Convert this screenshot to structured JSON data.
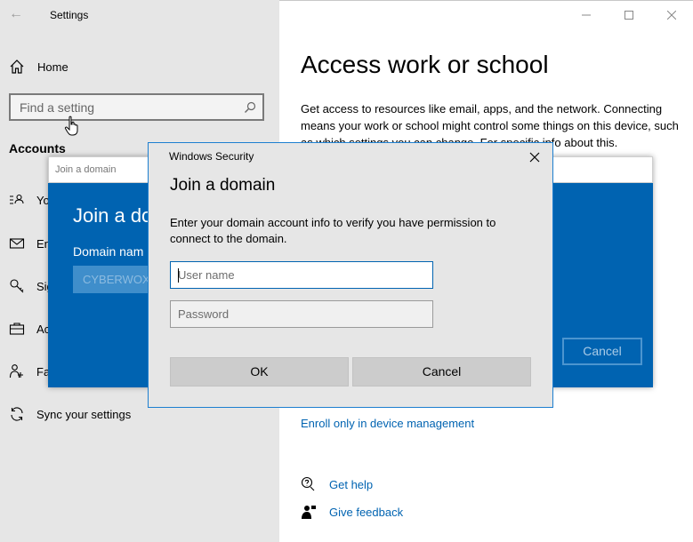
{
  "app": {
    "title": "Settings"
  },
  "sidebar": {
    "home_label": "Home",
    "search_placeholder": "Find a setting",
    "section_title": "Accounts",
    "items": [
      {
        "label": "Yo",
        "icon": "person-info-icon"
      },
      {
        "label": "En",
        "icon": "email-icon"
      },
      {
        "label": "Sig",
        "icon": "key-icon"
      },
      {
        "label": "Ac",
        "icon": "briefcase-icon"
      },
      {
        "label": "Fa",
        "icon": "family-icon"
      },
      {
        "label": "Sync your settings",
        "icon": "sync-icon"
      }
    ]
  },
  "main": {
    "title": "Access work or school",
    "description": "Get access to resources like email, apps, and the network. Connecting means your work or school might control some things on this device, such as which settings you can change. For specific info about this,",
    "enroll_link": "Enroll only in device management",
    "get_help": "Get help",
    "give_feedback": "Give feedback"
  },
  "join_domain_dialog": {
    "titlebar": "Join a domain",
    "heading": "Join a do",
    "domain_label": "Domain nam",
    "domain_value": "CYBERWOX",
    "cancel_label": "Cancel"
  },
  "security_dialog": {
    "caption": "Windows Security",
    "heading": "Join a domain",
    "description": "Enter your domain account info to verify you have permission to connect to the domain.",
    "username_placeholder": "User name",
    "password_placeholder": "Password",
    "ok_label": "OK",
    "cancel_label": "Cancel"
  },
  "colors": {
    "accent": "#0063b1",
    "sidebar_bg": "#e6e6e6",
    "dialog_bg": "#e6e6e6"
  }
}
